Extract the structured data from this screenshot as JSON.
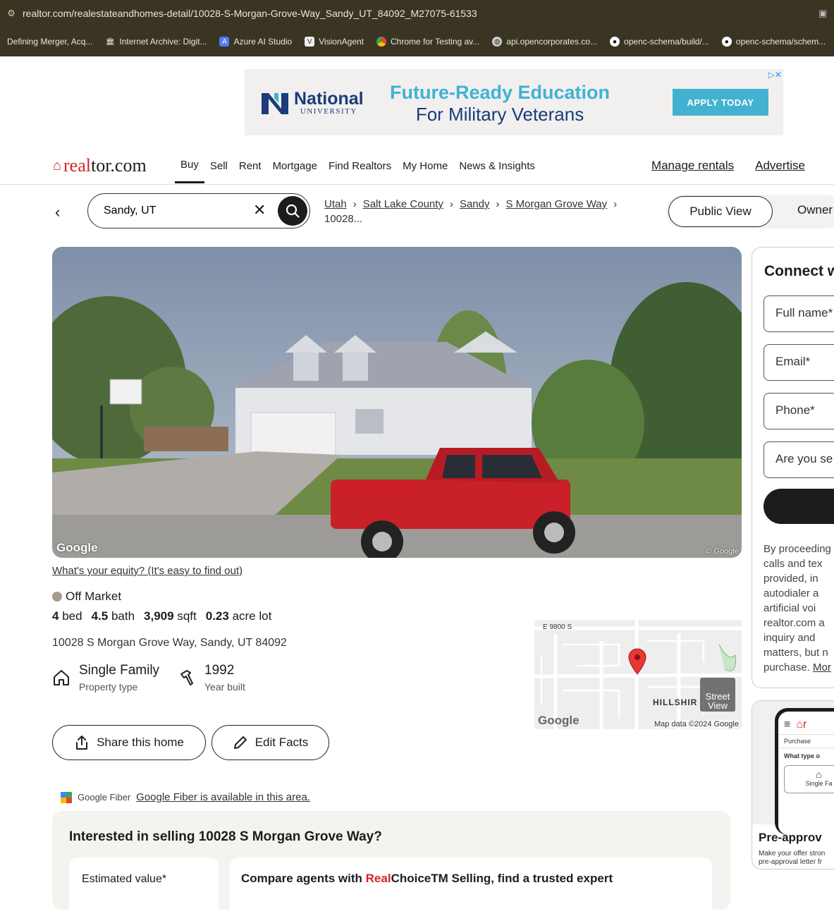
{
  "browser": {
    "url": "realtor.com/realestateandhomes-detail/10028-S-Morgan-Grove-Way_Sandy_UT_84092_M27075-61533",
    "bookmarks": [
      {
        "label": "Defining Merger, Acq...",
        "icon": "page-icon"
      },
      {
        "label": "Internet Archive: Digit...",
        "icon": "archive-icon"
      },
      {
        "label": "Azure AI Studio",
        "icon": "azure-icon"
      },
      {
        "label": "VisionAgent",
        "icon": "visionagent-icon"
      },
      {
        "label": "Chrome for Testing av...",
        "icon": "chrome-icon"
      },
      {
        "label": "api.opencorporates.co...",
        "icon": "globe-icon"
      },
      {
        "label": "openc-schema/build/...",
        "icon": "github-icon"
      },
      {
        "label": "openc-schema/schem...",
        "icon": "github-icon"
      }
    ]
  },
  "ad": {
    "brand_name": "National",
    "brand_sub": "UNIVERSITY",
    "headline1": "Future-Ready Education",
    "headline2": "For Military Veterans",
    "cta": "APPLY TODAY"
  },
  "nav": {
    "logo_part1": "real",
    "logo_part2": "tor.com",
    "items": [
      "Buy",
      "Sell",
      "Rent",
      "Mortgage",
      "Find Realtors",
      "My Home",
      "News & Insights"
    ],
    "right": [
      "Manage rentals",
      "Advertise"
    ]
  },
  "search": {
    "value": "Sandy, UT"
  },
  "breadcrumb": [
    "Utah",
    "Salt Lake County",
    "Sandy",
    "S Morgan Grove Way",
    "10028..."
  ],
  "view_toggle": {
    "public": "Public View",
    "owner": "Owner"
  },
  "photo": {
    "google_mark": "Google",
    "copyright": "© Google"
  },
  "property": {
    "equity_link": "What's your equity? (It's easy to find out)",
    "status": "Off Market",
    "beds": "4",
    "beds_label": "bed",
    "baths": "4.5",
    "baths_label": "bath",
    "sqft": "3,909",
    "sqft_label": "sqft",
    "lot": "0.23",
    "lot_label": "acre lot",
    "address": "10028 S Morgan Grove Way, Sandy, UT 84092",
    "type_value": "Single Family",
    "type_label": "Property type",
    "year_value": "1992",
    "year_label": "Year built"
  },
  "actions": {
    "share": "Share this home",
    "edit": "Edit Facts"
  },
  "map": {
    "street_label": "E 9800 S",
    "area_label": "HILLSHIR",
    "street_view": "Street View",
    "google": "Google",
    "data": "Map data ©2024 Google"
  },
  "fiber": {
    "brand": "Google Fiber",
    "link": "Google Fiber is available in this area."
  },
  "sell": {
    "title": "Interested in selling 10028 S Morgan Grove Way?",
    "estimated": "Estimated value*",
    "compare_prefix": "Compare agents with ",
    "compare_red": "Real",
    "compare_suffix": "ChoiceTM Selling, find a trusted expert"
  },
  "connect": {
    "title": "Connect w",
    "fields": [
      "Full name*",
      "Email*",
      "Phone*",
      "Are you se"
    ],
    "disclaimer_lines": [
      "By proceeding",
      "calls and tex",
      "provided, in",
      "autodialer a",
      "artificial voi",
      "realtor.com a",
      "inquiry and",
      "matters, but n",
      "purchase. "
    ],
    "more": "Mor"
  },
  "preapproval": {
    "phone_header": "Purchase",
    "phone_question": "What type o",
    "phone_option": "Single Fa",
    "title": "Pre-approv",
    "text1": "Make your offer stron",
    "text2": "pre-approval letter fr"
  }
}
